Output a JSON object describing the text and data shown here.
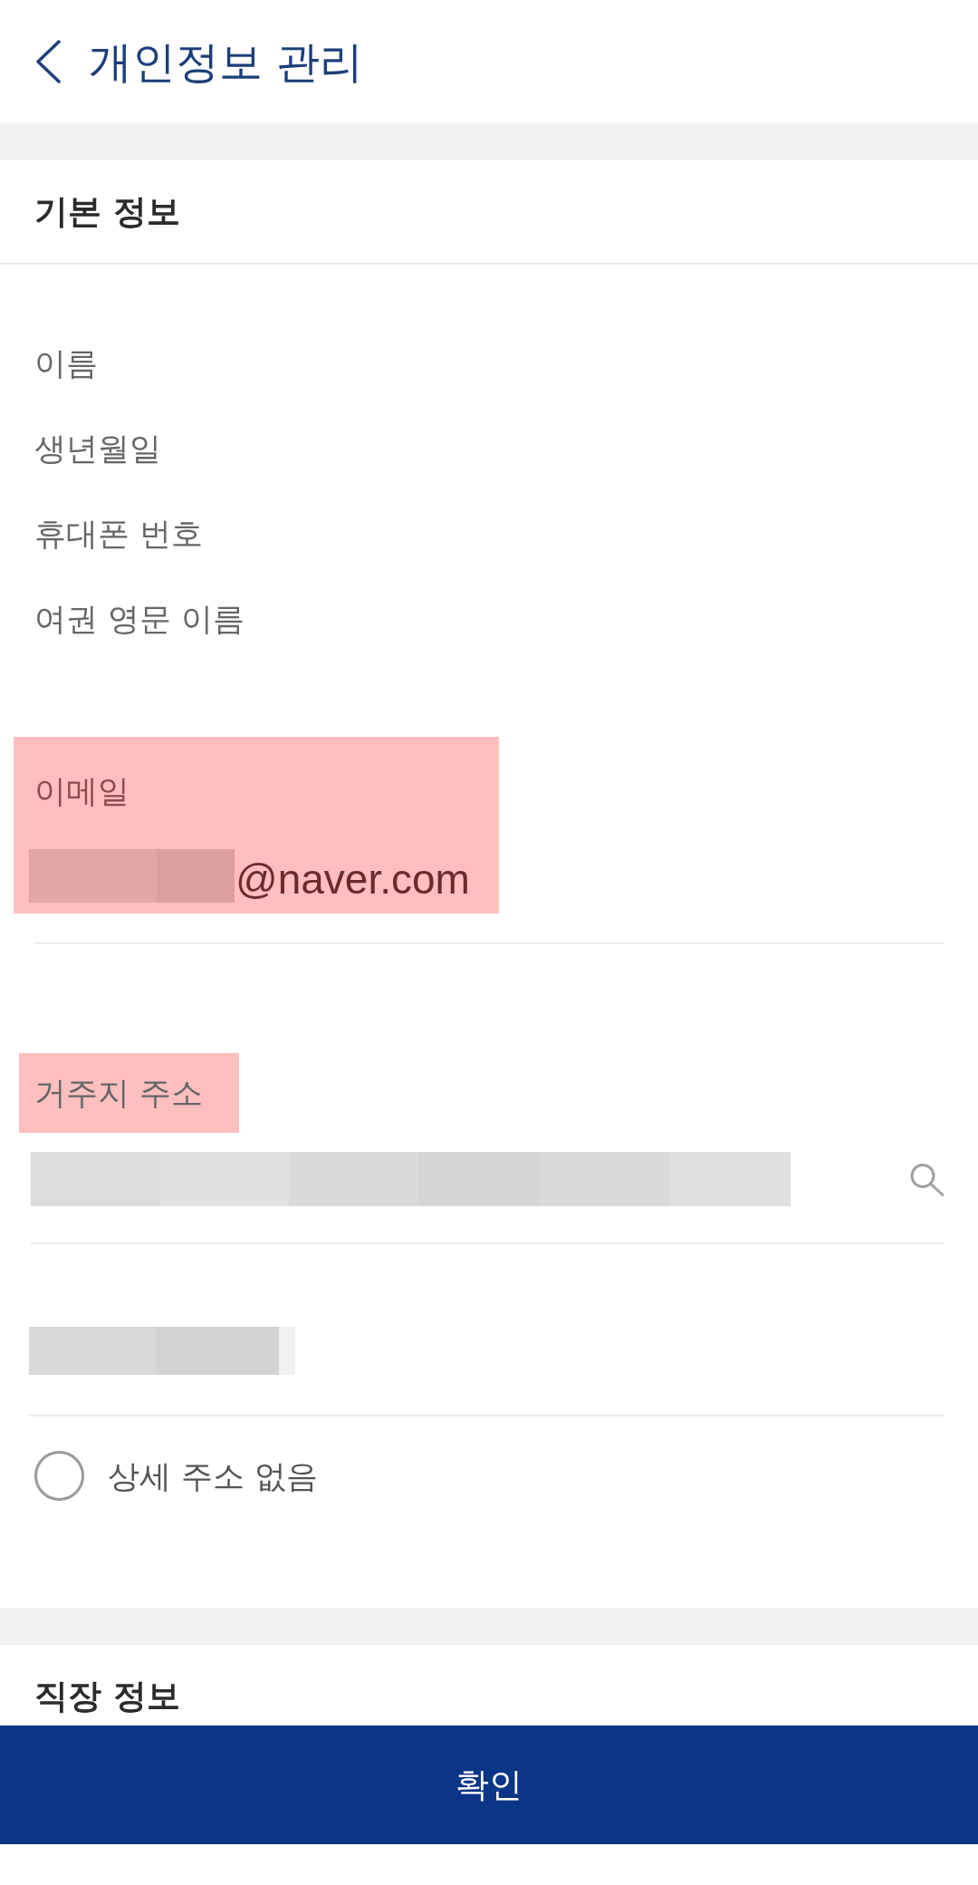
{
  "header": {
    "title": "개인정보 관리"
  },
  "basic_info": {
    "title": "기본 정보",
    "fields": [
      {
        "label": "이름"
      },
      {
        "label": "생년월일"
      },
      {
        "label": "휴대폰 번호"
      },
      {
        "label": "여권 영문 이름"
      }
    ],
    "email": {
      "label": "이메일",
      "value": "@naver.com",
      "highlighted": true,
      "redacted": true
    },
    "address": {
      "label": "거주지 주소",
      "highlighted": true,
      "redacted": true
    },
    "address_detail": {
      "redacted": true
    },
    "no_detail_address": {
      "label": "상세 주소 없음",
      "checked": false
    }
  },
  "work_info": {
    "title": "직장 정보"
  },
  "confirm_button": {
    "label": "확인"
  }
}
